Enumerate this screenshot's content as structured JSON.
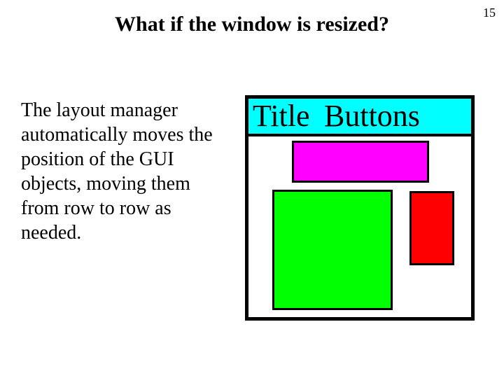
{
  "page_number": "15",
  "heading": "What if the window is resized?",
  "body_text": "The layout manager automatically moves the position of the GUI objects, moving them from row to row as needed.",
  "gui": {
    "title_label": "Title",
    "buttons_label": "Buttons"
  }
}
